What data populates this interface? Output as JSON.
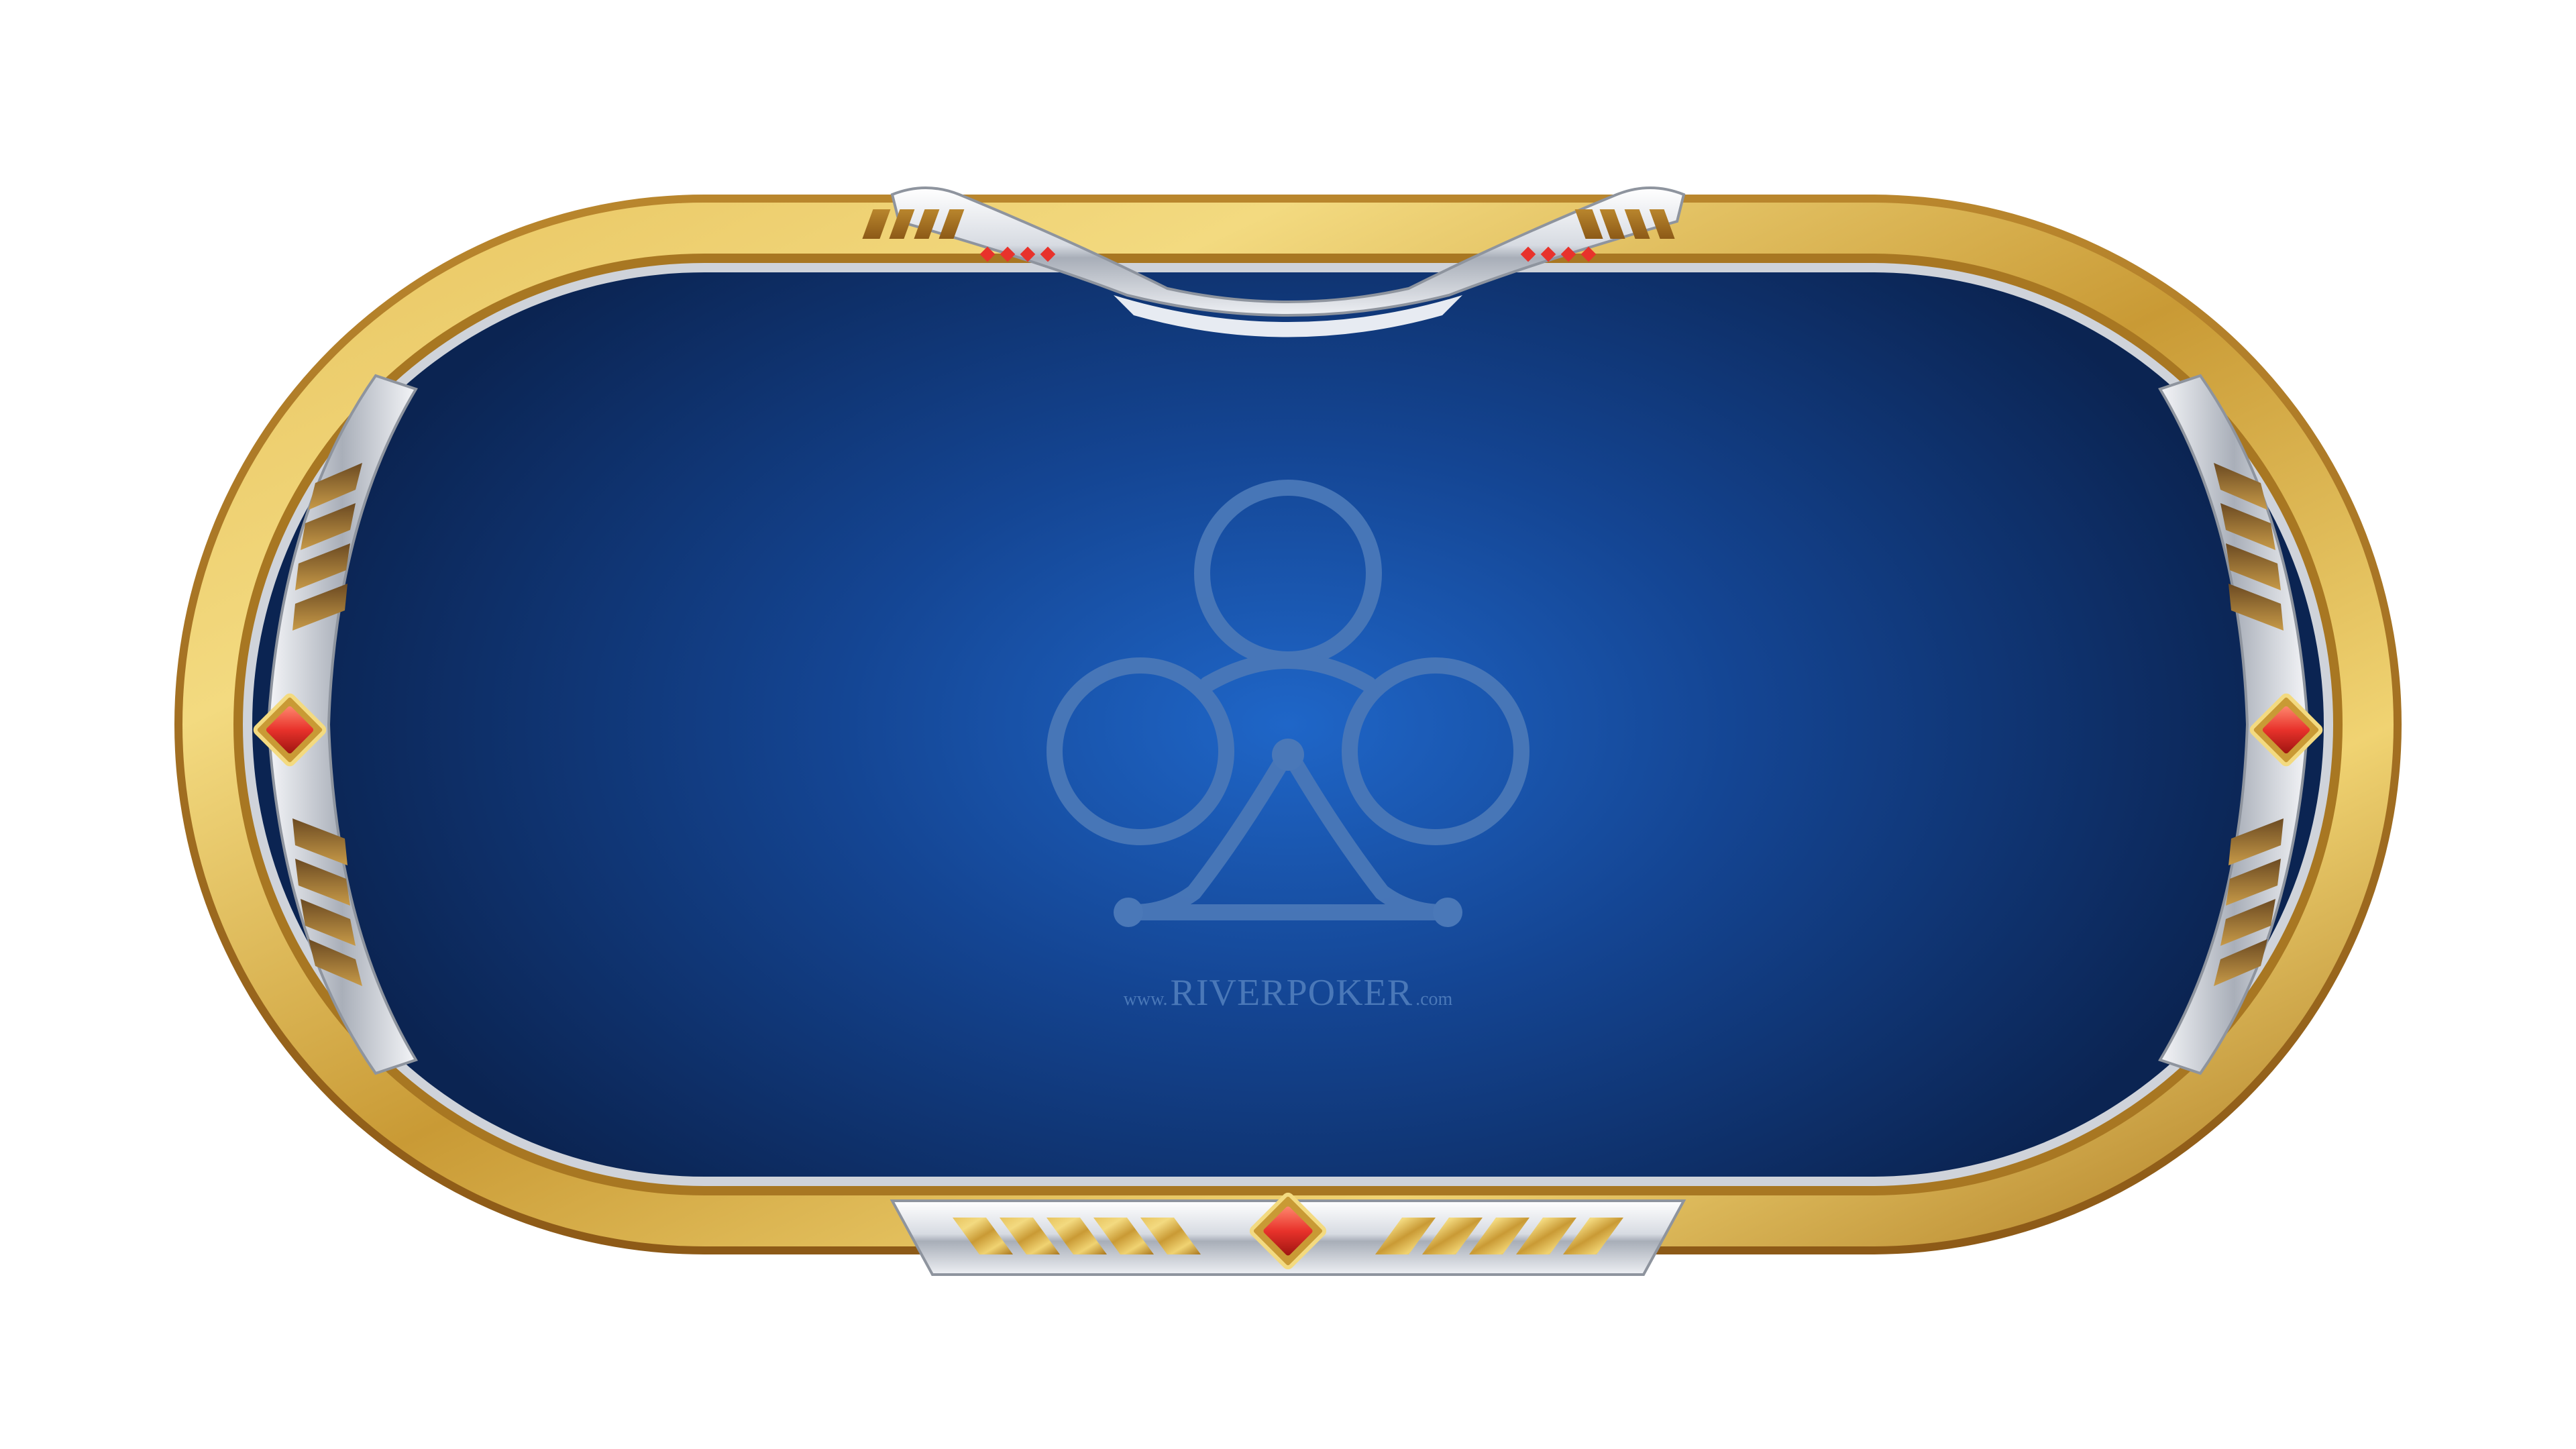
{
  "table": {
    "watermark_prefix": "www.",
    "watermark_brand": "RIVERPOKER",
    "watermark_suffix": ".com",
    "felt_center_color": "#1f66c8",
    "felt_edge_color": "#0c2452",
    "rail_gold_light": "#f2d67a",
    "rail_gold_dark": "#b07d22",
    "trim_silver": "#e4e7ec",
    "gem_color": "#e8322b"
  },
  "icons": {
    "center_logo": "club-suit-icon",
    "side_gems": "diamond-gem-icon",
    "top_lights": "indicator-light-icon"
  }
}
